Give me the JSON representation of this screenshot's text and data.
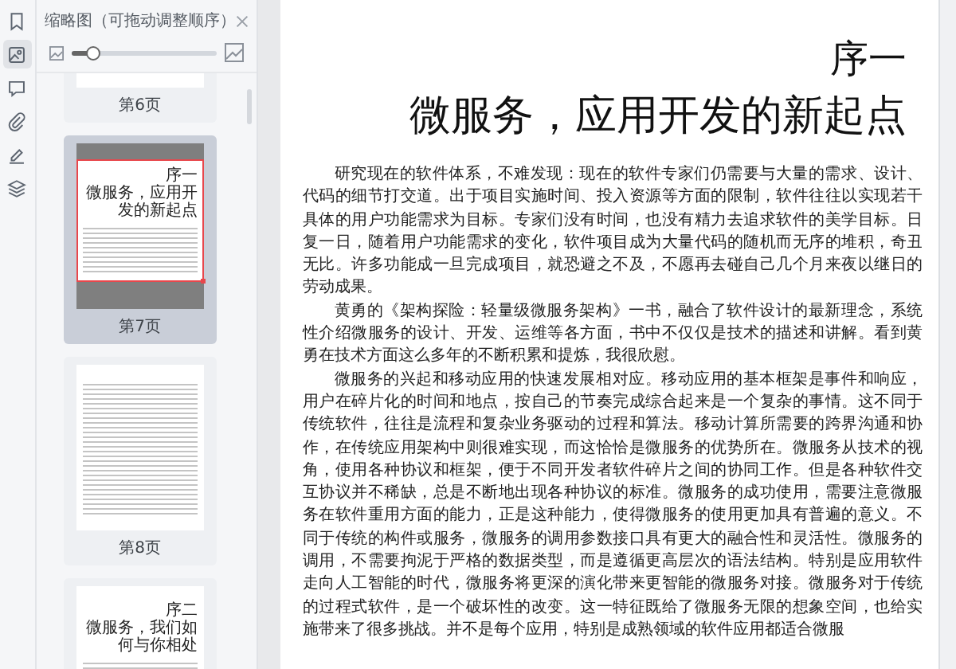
{
  "rail": [
    {
      "kind": "bookmark",
      "selected": false
    },
    {
      "kind": "thumbnails",
      "selected": true
    },
    {
      "kind": "comment",
      "selected": false
    },
    {
      "kind": "attachment",
      "selected": false
    },
    {
      "kind": "signature",
      "selected": false
    },
    {
      "kind": "layers",
      "selected": false
    }
  ],
  "panel": {
    "title": "缩略图（可拖动调整顺序）",
    "zoom": {
      "level": 0.15
    }
  },
  "thumbnails": [
    {
      "label": "第6页",
      "selected": false,
      "viewport": false
    },
    {
      "label": "第7页",
      "selected": true,
      "viewport": true,
      "heading": "序一",
      "title": "微服务，应用开发的新起点"
    },
    {
      "label": "第8页",
      "selected": false,
      "viewport": false
    },
    {
      "selected": false,
      "viewport": false,
      "heading": "序二",
      "title": "微服务，我们如何与你相处"
    }
  ],
  "document": {
    "heading": "序一",
    "title": "微服务，应用开发的新起点",
    "paragraphs": [
      "研究现在的软件体系，不难发现：现在的软件专家们仍需要与大量的需求、设计、代码的细节打交道。出于项目实施时间、投入资源等方面的限制，软件往往以实现若干具体的用户功能需求为目标。专家们没有时间，也没有精力去追求软件的美学目标。日复一日，随着用户功能需求的变化，软件项目成为大量代码的随机而无序的堆积，奇丑无比。许多功能成一旦完成项目，就恐避之不及，不愿再去碰自己几个月来夜以继日的劳动成果。",
      "黄勇的《架构探险：轻量级微服务架构》一书，融合了软件设计的最新理念，系统性介绍微服务的设计、开发、运维等各方面，书中不仅仅是技术的描述和讲解。看到黄勇在技术方面这么多年的不断积累和提炼，我很欣慰。",
      "微服务的兴起和移动应用的快速发展相对应。移动应用的基本框架是事件和响应，用户在碎片化的时间和地点，按自己的节奏完成综合起来是一个复杂的事情。这不同于传统软件，往往是流程和复杂业务驱动的过程和算法。移动计算所需要的跨界沟通和协作，在传统应用架构中则很难实现，而这恰恰是微服务的优势所在。微服务从技术的视角，使用各种协议和框架，便于不同开发者软件碎片之间的协同工作。但是各种软件交互协议并不稀缺，总是不断地出现各种协议的标准。微服务的成功使用，需要注意微服务在软件重用方面的能力，正是这种能力，使得微服务的使用更加具有普遍的意义。不同于传统的构件或服务，微服务的调用参数接口具有更大的融合性和灵活性。微服务的调用，不需要拘泥于严格的数据类型，而是遵循更高层次的语法结构。特别是应用软件走向人工智能的时代，微服务将更深的演化带来更智能的微服务对接。微服务对于传统的过程式软件，是一个破坏性的改变。这一特征既给了微服务无限的想象空间，也给实施带来了很多挑战。并不是每个应用，特别是成熟领域的软件应用都适合微服"
    ]
  }
}
